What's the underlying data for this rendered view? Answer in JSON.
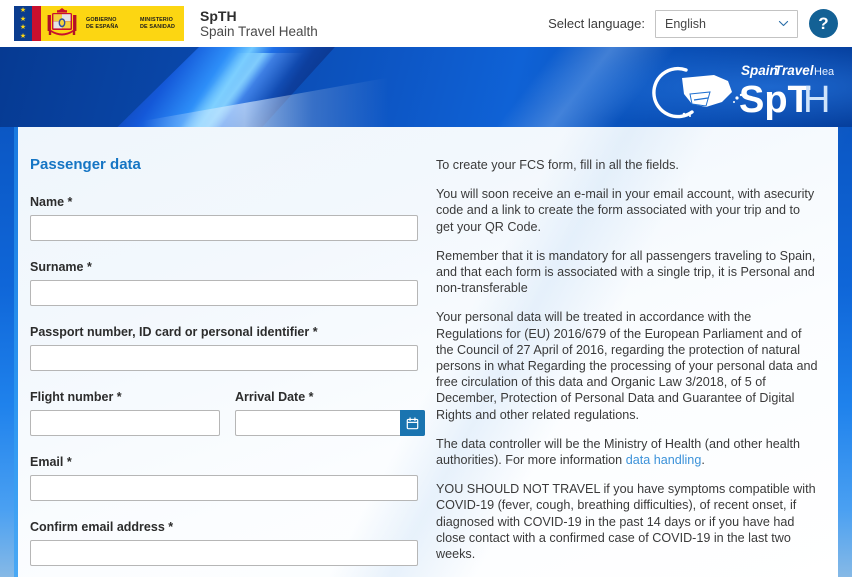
{
  "header": {
    "gov_logo": {
      "icon": "spain-government-flag-crest",
      "gobierno_line1": "GOBIERNO",
      "gobierno_line2": "DE ESPAÑA",
      "ministerio_line1": "MINISTERIO",
      "ministerio_line2": "DE SANIDAD"
    },
    "brand_abbr": "SpTH",
    "brand_full": "Spain Travel Health",
    "language_label": "Select language:",
    "language_selected": "English",
    "language_options": [
      "English"
    ],
    "help_label": "?"
  },
  "banner": {
    "logo_top_bold_1": "Spain",
    "logo_top_bold_2": "Travel",
    "logo_top_light": "Health",
    "logo_main_sp": "SpT",
    "logo_main_h": "H",
    "logo_icon": "spain-map-globe-icon"
  },
  "form": {
    "section_title": "Passenger data",
    "fields": [
      {
        "label": "Name *",
        "value": "",
        "placeholder": "",
        "name": "name-input"
      },
      {
        "label": "Surname *",
        "value": "",
        "placeholder": "",
        "name": "surname-input"
      },
      {
        "label": "Passport number, ID card or personal identifier *",
        "value": "",
        "placeholder": "",
        "name": "passport-input"
      }
    ],
    "flight_label": "Flight number *",
    "flight_value": "",
    "arrival_label": "Arrival Date *",
    "arrival_value": "",
    "arrival_icon": "calendar-icon",
    "email_label": "Email *",
    "email_value": "",
    "confirm_email_label": "Confirm email address *",
    "confirm_email_value": ""
  },
  "info": {
    "p1": "To create your FCS form, fill in all the fields.",
    "p2": "You will soon receive an e-mail in your email account, with asecurity code and a link to create the form associated with your trip and to get your QR Code.",
    "p3": "Remember that it is mandatory for all passengers traveling to Spain, and that each form is associated with a single trip, it is Personal and non-transferable",
    "p4": "Your personal data will be treated in accordance with the Regulations for (EU) 2016/679 of the European Parliament and of the Council of 27 April of 2016, regarding the protection of natural persons in what Regarding the processing of your personal data and free circulation of this data and Organic Law 3/2018, of 5 of December, Protection of Personal Data and Guarantee of Digital Rights and other related regulations.",
    "p5_before": "The data controller will be the Ministry of Health (and other health authorities). For more information ",
    "p5_link": "data handling",
    "p5_after": ".",
    "p6": "YOU SHOULD NOT TRAVEL if you have symptoms compatible with COVID-19 (fever, cough, breathing difficulties), of recent onset, if diagnosed with COVID-19 in the past 14 days or if you have had close contact with a confirmed case of COVID-19 in the last two weeks."
  },
  "colors": {
    "brand_blue": "#1575c4",
    "banner_blue": "#0b57c4",
    "link_blue": "#3b92d9",
    "flag_yellow": "#fcd612",
    "flag_red": "#c8102e",
    "help_blue": "#136195"
  }
}
